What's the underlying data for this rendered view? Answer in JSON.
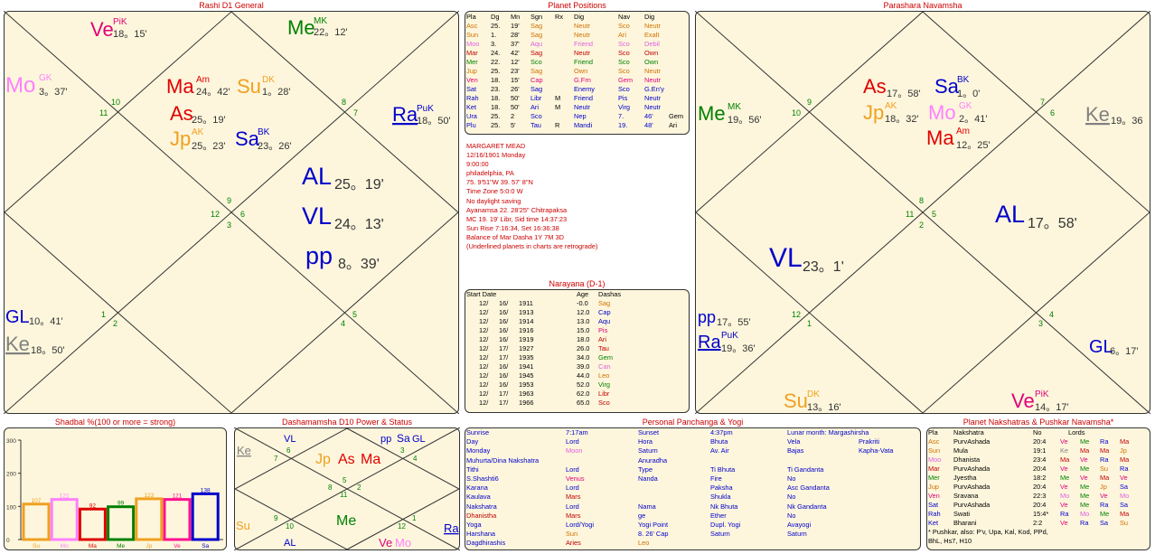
{
  "titles": {
    "rashi": "Rashi D1 General",
    "planet_positions": "Planet Positions",
    "navamsha": "Parashara Navamsha",
    "narayana": "Narayana (D-1)",
    "shadbal": "Shadbal %(100 or more = strong)",
    "dasha": "Dashamamsha D10 Power & Status",
    "panchang": "Personal Panchanga & Yogi",
    "nakshatra": "Planet Nakshatras & Pushkar Navamsha*"
  },
  "rashi": {
    "houses": [
      "10",
      "11",
      "8",
      "7",
      "9",
      "12",
      "6",
      "3",
      "1",
      "2",
      "5",
      "4"
    ],
    "ve": "Ve",
    "ve_sup": "PiK",
    "ve_sub": "18。15'",
    "me": "Me",
    "me_sup": "MK",
    "me_sub": "22。12'",
    "mo": "Mo",
    "mo_sup": "GK",
    "mo_sub": "3。37'",
    "ma": "Ma",
    "ma_sup": "Am",
    "ma_sub": "24。42'",
    "su": "Su",
    "su_sup": "DK",
    "su_sub": "1。28'",
    "as": "As",
    "as_sub": "25。19'",
    "jp": "Jp",
    "jp_sup": "AK",
    "jp_sub": "25。23'",
    "sa": "Sa",
    "sa_sup": "BK",
    "sa_sub": "23。26'",
    "ra": "Ra",
    "ra_sup": "PuK",
    "ra_sub": "18。50'",
    "al": "AL",
    "al_sub": "25。19'",
    "vl": "VL",
    "vl_sub": "24。13'",
    "pp": "pp",
    "pp_sub": "8。39'",
    "gl": "GL",
    "gl_sub": "10。41'",
    "ke": "Ke",
    "ke_sub": "18。50'"
  },
  "positions": {
    "headers": [
      "Pla",
      "Dg",
      "Mn",
      "Sgn",
      "Rx",
      "Dig",
      "Nav",
      "Dig"
    ],
    "rows": [
      [
        "Asc",
        "25.",
        "19'",
        "Sag",
        "",
        "Neutr",
        "Sco",
        "Neutr"
      ],
      [
        "Sun",
        "1.",
        "28'",
        "Sag",
        "",
        "Neutr",
        "Ari",
        "Exalt"
      ],
      [
        "Moo",
        "3.",
        "37'",
        "Aqu",
        "",
        "Friend",
        "Sco",
        "Debil"
      ],
      [
        "Mar",
        "24.",
        "42'",
        "Sag",
        "",
        "Neutr",
        "Sco",
        "Own"
      ],
      [
        "Mer",
        "22.",
        "12'",
        "Sco",
        "",
        "Friend",
        "Sco",
        "Own"
      ],
      [
        "Jup",
        "25.",
        "23'",
        "Sag",
        "",
        "Own",
        "Sco",
        "Neutr"
      ],
      [
        "Ven",
        "18.",
        "15'",
        "Cap",
        "",
        "G.Frn",
        "Gem",
        "Neutr"
      ],
      [
        "Sat",
        "23.",
        "26'",
        "Sag",
        "",
        "Enemy",
        "Sco",
        "G.En'y"
      ],
      [
        "Rah",
        "18.",
        "50'",
        "Libr",
        "M",
        "Friend",
        "Pis",
        "Neutr"
      ],
      [
        "Ket",
        "18.",
        "50'",
        "Ari",
        "M",
        "Neutr",
        "Virg",
        "Neutr"
      ],
      [
        "Ura",
        "25.",
        "2",
        "Sco",
        "",
        "Nep",
        "7.",
        "46'",
        "Gem"
      ],
      [
        "Plu",
        "25.",
        "5'",
        "Tau",
        "R",
        "Mandi",
        "19.",
        "48'",
        "Ari"
      ]
    ],
    "colors": [
      "#d07000",
      "#d07000",
      "#e060e0",
      "#c00000",
      "#008000",
      "#d07000",
      "#e0007a",
      "#0000cc",
      "#0000cc",
      "#0000cc",
      "#0000cc",
      "#0000cc"
    ]
  },
  "info": [
    "MARGARET MEAD",
    "12/16/1901 Monday",
    "9:00:00",
    "philadelphia, PA",
    "75.  9'51\"W 39.  57' 8\"N",
    "Time Zone 5:0:0 W",
    "No daylight saving",
    "Ayanamsa 22.  28'25\" Chitrapaksa",
    "MC 19.  19' Libr, Sid time 14:37:23",
    "Sun Rise 7:16:34, Set 16:36:38",
    "Balance of Mar Dasha 1Y 7M 3D",
    "(Underlined planets in charts are retrograde)"
  ],
  "narayana": {
    "h_start": "Start Date",
    "h_age": "Age",
    "h_dasha": "Dashas",
    "rows": [
      [
        "12/",
        "16/",
        "1911",
        "-0.0",
        "Sag"
      ],
      [
        "12/",
        "16/",
        "1913",
        "12.0",
        "Cap"
      ],
      [
        "12/",
        "16/",
        "1914",
        "13.0",
        "Aqu"
      ],
      [
        "12/",
        "16/",
        "1916",
        "15.0",
        "Pis"
      ],
      [
        "12/",
        "16/",
        "1919",
        "18.0",
        "Ari"
      ],
      [
        "12/",
        "17/",
        "1927",
        "26.0",
        "Tau"
      ],
      [
        "12/",
        "17/",
        "1935",
        "34.0",
        "Gem"
      ],
      [
        "12/",
        "16/",
        "1941",
        "39.0",
        "Can"
      ],
      [
        "12/",
        "16/",
        "1945",
        "44.0",
        "Leo"
      ],
      [
        "12/",
        "16/",
        "1953",
        "52.0",
        "Virg"
      ],
      [
        "12/",
        "17/",
        "1963",
        "62.0",
        "Libr"
      ],
      [
        "12/",
        "17/",
        "1966",
        "65.0",
        "Sco"
      ]
    ],
    "colors": [
      "#d07000",
      "#0000cc",
      "#0000cc",
      "#e0007a",
      "#c00000",
      "#c00000",
      "#008000",
      "#e060e0",
      "#d07000",
      "#008000",
      "#c00000",
      "#c00000"
    ]
  },
  "navamsha": {
    "houses": [
      "10",
      "9",
      "7",
      "6",
      "11",
      "8",
      "5",
      "2",
      "12",
      "1",
      "3",
      "4"
    ],
    "as": "As",
    "as_sub": "17。58'",
    "sa": "Sa",
    "sa_sup": "BK",
    "sa_sub": "1。0'",
    "jp": "Jp",
    "jp_sup": "AK",
    "jp_sub": "18。32'",
    "mo": "Mo",
    "mo_sup": "GK",
    "mo_sub": "2。41'",
    "ma": "Ma",
    "ma_sup": "Am",
    "ma_sub": "12。25'",
    "me": "Me",
    "me_sup": "MK",
    "me_sub": "19。56'",
    "ke": "Ke",
    "ke_sub": "19。36",
    "al": "AL",
    "al_sub": "17。58'",
    "vl": "VL",
    "vl_sub": "23。1'",
    "pp": "pp",
    "pp_sub": "17。55'",
    "ra": "Ra",
    "ra_sup": "PuK",
    "ra_sub": "19。36'",
    "gl": "GL",
    "gl_sub": "6。17'",
    "su": "Su",
    "su_sup": "DK",
    "su_sub": "13。16'",
    "ve": "Ve",
    "ve_sup": "PiK",
    "ve_sub": "14。17'"
  },
  "chart_data": {
    "type": "bar",
    "categories": [
      "Su",
      "Mo",
      "Ma",
      "Me",
      "Jp",
      "Ve",
      "Sa"
    ],
    "values": [
      107,
      121,
      92,
      99,
      123,
      121,
      138
    ],
    "ylim": [
      0,
      300
    ],
    "yticks": [
      "300",
      "200",
      "100",
      "0"
    ],
    "colors": [
      "#f0a020",
      "#ff80ff",
      "#e00000",
      "#008000",
      "#f0a020",
      "#ff1090",
      "#0000cc"
    ]
  },
  "dasha": {
    "houses": [
      "6",
      "7",
      "3",
      "4",
      "5",
      "8",
      "2",
      "11",
      "9",
      "10",
      "12",
      "1"
    ],
    "ke": "Ke",
    "vl": "VL",
    "jp": "Jp",
    "as": "As",
    "ma": "Ma",
    "pp": "pp",
    "sa": "Sa",
    "gl": "GL",
    "su": "Su",
    "me": "Me",
    "al": "AL",
    "ve": "Ve",
    "mo": "Mo",
    "ra": "Ra"
  },
  "panchang": {
    "rows": [
      [
        [
          "Sunrise",
          "#0000cc"
        ],
        [
          "7:17am",
          "#0000cc"
        ],
        [
          "Sunset",
          "#0000cc"
        ],
        [
          "4:37pm",
          "#0000cc"
        ],
        [
          "Lunar month: Margashirsha",
          "#0000cc"
        ],
        [
          "",
          ""
        ]
      ],
      [
        [
          "Day",
          "#0000cc"
        ],
        [
          "Lord",
          "#0000cc"
        ],
        [
          "Hora",
          "#0000cc"
        ],
        [
          "Bhuta",
          "#0000cc"
        ],
        [
          "Vela",
          "#0000cc"
        ],
        [
          "Prakriti",
          "#0000cc"
        ]
      ],
      [
        [
          "Monday",
          "#0000cc"
        ],
        [
          "Moon",
          "#e060e0"
        ],
        [
          "Saturn",
          "#0000cc"
        ],
        [
          "Av. Air",
          "#0000cc"
        ],
        [
          "Bajas",
          "#0000cc"
        ],
        [
          "Kapha-Vata",
          "#0000cc"
        ]
      ],
      [
        [
          "Muhurta/Dina Nakshatra",
          "#0000cc"
        ],
        [
          "",
          ""
        ],
        [
          "Anuradha",
          "#0000cc"
        ],
        [
          "",
          ""
        ],
        [
          "",
          ""
        ],
        [
          "",
          ""
        ]
      ],
      [
        [
          "Tithi",
          "#0000cc"
        ],
        [
          "Lord",
          "#0000cc"
        ],
        [
          "Type",
          "#0000cc"
        ],
        [
          "Ti Bhuta",
          "#0000cc"
        ],
        [
          "Ti Gandanta",
          "#0000cc"
        ],
        [
          "",
          ""
        ]
      ],
      [
        [
          "S.Shashti6",
          "#0000cc"
        ],
        [
          "Venus",
          "#e0007a"
        ],
        [
          "Nanda",
          "#0000cc"
        ],
        [
          "Fire",
          "#0000cc"
        ],
        [
          "No",
          "#0000cc"
        ],
        [
          "",
          ""
        ]
      ],
      [
        [
          "Karana",
          "#0000cc"
        ],
        [
          "Lord",
          "#0000cc"
        ],
        [
          "",
          ""
        ],
        [
          "Paksha",
          "#0000cc"
        ],
        [
          "Asc Gandanta",
          "#0000cc"
        ],
        [
          "",
          ""
        ]
      ],
      [
        [
          "Kaulava",
          "#0000cc"
        ],
        [
          "Mars",
          "#c00000"
        ],
        [
          "",
          ""
        ],
        [
          "Shukla",
          "#0000cc"
        ],
        [
          "No",
          "#0000cc"
        ],
        [
          "",
          ""
        ]
      ],
      [
        [
          "Nakshatra",
          "#0000cc"
        ],
        [
          "Lord",
          "#0000cc"
        ],
        [
          "Nama",
          "#0000cc"
        ],
        [
          "Nk Bhuta",
          "#0000cc"
        ],
        [
          "Nk Gandanta",
          "#0000cc"
        ],
        [
          "",
          ""
        ]
      ],
      [
        [
          "Dhanistha",
          "#c00000"
        ],
        [
          "Mars",
          "#c00000"
        ],
        [
          "ge",
          "#0000cc"
        ],
        [
          "Ether",
          "#0000cc"
        ],
        [
          "No",
          "#0000cc"
        ],
        [
          "",
          ""
        ]
      ],
      [
        [
          "Yoga",
          "#0000cc"
        ],
        [
          "Lord/Yogi",
          "#0000cc"
        ],
        [
          "Yogi Point",
          "#0000cc"
        ],
        [
          "Dupl. Yogi",
          "#0000cc"
        ],
        [
          "Avayogi",
          "#0000cc"
        ],
        [
          "",
          ""
        ]
      ],
      [
        [
          "Harshana",
          "#0000cc"
        ],
        [
          "Sun",
          "#d07000"
        ],
        [
          "8.  26' Cap",
          "#0000cc"
        ],
        [
          "Saturn",
          "#0000cc"
        ],
        [
          "Saturn",
          "#0000cc"
        ],
        [
          "",
          ""
        ]
      ],
      [
        [
          "Dagdhirashis",
          "#0000cc"
        ],
        [
          "Aries",
          "#c00000"
        ],
        [
          "Leo",
          "#d07000"
        ],
        [
          "",
          ""
        ],
        [
          "",
          ""
        ],
        [
          "",
          ""
        ]
      ]
    ]
  },
  "nakshatra": {
    "headers": [
      "Pla",
      "Nakshatra",
      "No",
      "Lords"
    ],
    "rows": [
      [
        "Asc",
        "PurvAshada",
        "20:4",
        "Ve",
        "Me",
        "Ra",
        "Ma"
      ],
      [
        "Sun",
        "Mula",
        "19:1",
        "Ke",
        "Ma",
        "Ma",
        "Jp"
      ],
      [
        "Moo",
        "Dhanista",
        "23:4",
        "Ma",
        "Ve",
        "Ra",
        "Ma"
      ],
      [
        "Mar",
        "PurvAshada",
        "20:4",
        "Ve",
        "Me",
        "Su",
        "Ra"
      ],
      [
        "Mer",
        "Jyestha",
        "18:2",
        "Me",
        "Ve",
        "Ma",
        "Ve"
      ],
      [
        "Jup",
        "PurvAshada",
        "20:4",
        "Ve",
        "Me",
        "Jp",
        "Sa"
      ],
      [
        "Ven",
        "Sravana",
        "22:3",
        "Mo",
        "Me",
        "Ve",
        "Mo"
      ],
      [
        "Sat",
        "PurvAshada",
        "20:4",
        "Ve",
        "Me",
        "Ra",
        "Sa"
      ],
      [
        "Rah",
        "Swati",
        "15:4*",
        "Ra",
        "Mo",
        "Me",
        "Ma"
      ],
      [
        "Ket",
        "Bharani",
        "2:2",
        "Ve",
        "Ra",
        "Sa",
        "Su"
      ]
    ],
    "plcolors": [
      "#d07000",
      "#d07000",
      "#e060e0",
      "#c00000",
      "#008000",
      "#d07000",
      "#e0007a",
      "#0000cc",
      "#0000cc",
      "#0000cc"
    ],
    "footer1": "* Pushkar, also:   P'v,    Upa,    Kal,    Kod,    PPd,",
    "footer2": "BhL,     Hs7,       H10"
  }
}
